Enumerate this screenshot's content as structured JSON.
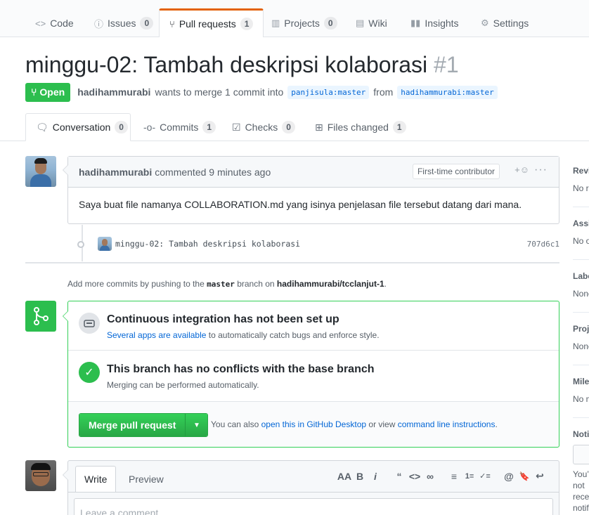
{
  "repo_nav": {
    "tabs": [
      {
        "label": "Code",
        "icon": "code-icon"
      },
      {
        "label": "Issues",
        "count": "0",
        "icon": "issue-icon"
      },
      {
        "label": "Pull requests",
        "count": "1",
        "icon": "pull-request-icon"
      },
      {
        "label": "Projects",
        "count": "0",
        "icon": "project-icon"
      },
      {
        "label": "Wiki",
        "icon": "book-icon"
      },
      {
        "label": "Insights",
        "icon": "graph-icon"
      },
      {
        "label": "Settings",
        "icon": "gear-icon"
      }
    ],
    "active_tab": "Pull requests",
    "accent_color": "#e36209"
  },
  "pr": {
    "title": "minggu-02: Tambah deskripsi kolaborasi",
    "number": "#1",
    "state": "Open",
    "author": "hadihammurabi",
    "merge_text": "wants to merge 1 commit into",
    "base_ref": "panjisula:master",
    "from_text": "from",
    "head_ref": "hadihammurabi:master"
  },
  "pr_tabs": [
    {
      "label": "Conversation",
      "count": "0",
      "icon": "comment-discussion-icon"
    },
    {
      "label": "Commits",
      "count": "1",
      "icon": "git-commit-icon"
    },
    {
      "label": "Checks",
      "count": "0",
      "icon": "checklist-icon"
    },
    {
      "label": "Files changed",
      "count": "1",
      "icon": "diff-icon"
    }
  ],
  "comment": {
    "author": "hadihammurabi",
    "action": "commented",
    "time": "9 minutes ago",
    "badge": "First-time contributor",
    "body": "Saya buat file namanya COLLABORATION.md yang isinya penjelasan file tersebut datang dari mana."
  },
  "commit": {
    "message": "minggu-02: Tambah deskripsi kolaborasi",
    "sha": "707d6c1"
  },
  "push_note": {
    "prefix": "Add more commits by pushing to the",
    "branch": "master",
    "mid": "branch on",
    "repo": "hadihammurabi/tcclanjut-1",
    "suffix": "."
  },
  "merge_box": {
    "ci_title": "Continuous integration has not been set up",
    "ci_link": "Several apps are available",
    "ci_rest": "to automatically catch bugs and enforce style.",
    "conflict_title": "This branch has no conflicts with the base branch",
    "conflict_sub": "Merging can be performed automatically.",
    "merge_button": "Merge pull request",
    "alt_prefix": "You can also",
    "alt_link1": "open this in GitHub Desktop",
    "alt_mid": "or view",
    "alt_link2": "command line instructions",
    "alt_suffix": "."
  },
  "new_comment": {
    "tab_write": "Write",
    "tab_preview": "Preview",
    "placeholder": "Leave a comment",
    "toolbar": [
      "AA",
      "B",
      "i",
      "“",
      "<>",
      "∞",
      "≡",
      "1≡",
      "✓≡",
      "@",
      "🔖",
      "↩"
    ]
  },
  "sidebar": {
    "sections": [
      {
        "title": "Reviewers",
        "value": "No reviews"
      },
      {
        "title": "Assignees",
        "value": "No one assigned"
      },
      {
        "title": "Labels",
        "value": "None yet"
      },
      {
        "title": "Projects",
        "value": "None yet"
      },
      {
        "title": "Milestone",
        "value": "No milestone"
      },
      {
        "title": "Notifications",
        "value": "You’re not receiving notifications"
      }
    ]
  },
  "colors": {
    "green": "#2cbe4e",
    "link": "#0366d6",
    "border": "#e1e4e8"
  }
}
